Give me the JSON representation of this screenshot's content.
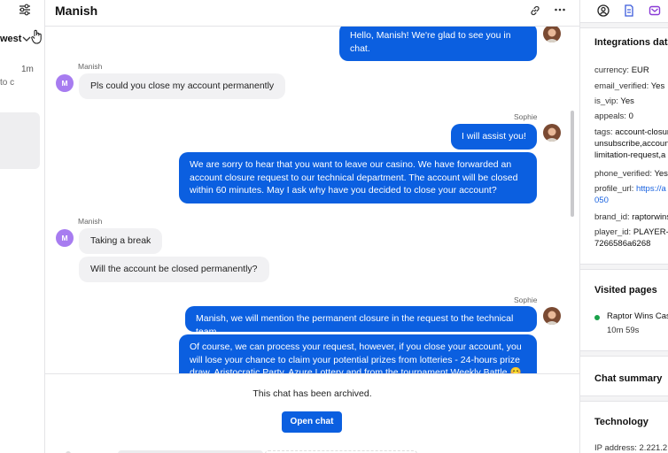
{
  "left_panel": {
    "sort_label": "west",
    "time": "1m",
    "preview": "to c"
  },
  "chat": {
    "title": "Manish",
    "messages": [
      {
        "from": "agent",
        "text": "Hello, Manish! We're glad to see you in chat."
      },
      {
        "from": "user",
        "sender": "Manish",
        "initial": "M",
        "text": "Pls could you close my account permanently"
      },
      {
        "from": "agent",
        "sender": "Sophie",
        "text": "I will assist you!"
      },
      {
        "from": "agent",
        "text": "We are sorry to hear that you want to leave our casino. We have forwarded an account closure request to our technical department. The account will be closed within 60 minutes. May I ask why have you decided to close your account?"
      },
      {
        "from": "user",
        "sender": "Manish",
        "initial": "M",
        "text": "Taking a break"
      },
      {
        "from": "user",
        "text": "Will the account be closed permanently?"
      },
      {
        "from": "agent",
        "sender": "Sophie",
        "text": "Manish, we will mention the permanent closure in the request to the technical team."
      },
      {
        "from": "agent",
        "text": "Of course, we can process your request, however, if you close your account, you will lose your chance to claim your potential prizes from lotteries - 24-hours prize draw, Aristocratic Party, Azure Lottery and from the tournament Weekly Battle 😊 Are you"
      }
    ],
    "archived_note": "This chat has been archived.",
    "open_chat_label": "Open chat"
  },
  "details": {
    "integrations_title": "Integrations data",
    "fields": [
      {
        "key": "currency:",
        "value": "EUR"
      },
      {
        "key": "email_verified:",
        "value": "Yes"
      },
      {
        "key": "is_vip:",
        "value": "Yes"
      },
      {
        "key": "appeals:",
        "value": "0"
      },
      {
        "key": "tags:",
        "value": "account-closure,",
        "cont": [
          "unsubscribe,account",
          "limitation-request,a"
        ]
      },
      {
        "key": "phone_verified:",
        "value": "Yes"
      },
      {
        "key": "profile_url:",
        "value": "https://a",
        "cont": [
          "050"
        ],
        "link": true
      },
      {
        "key": "brand_id:",
        "value": "raptorwins"
      },
      {
        "key": "player_id:",
        "value": "PLAYER-",
        "cont": [
          "7266586a6268"
        ]
      }
    ],
    "visited_title": "Visited pages",
    "visited_page": "Raptor Wins Casino",
    "visited_time": "10m 59s",
    "summary_title": "Chat summary",
    "technology_title": "Technology",
    "ip_address": "IP address: 2.221.2",
    "colors": {
      "agent_bubble": "#0b5fe0",
      "user_bubble": "#f1f1f3",
      "avatar": "#a77cf0",
      "visit_dot": "#1aa14a"
    }
  }
}
